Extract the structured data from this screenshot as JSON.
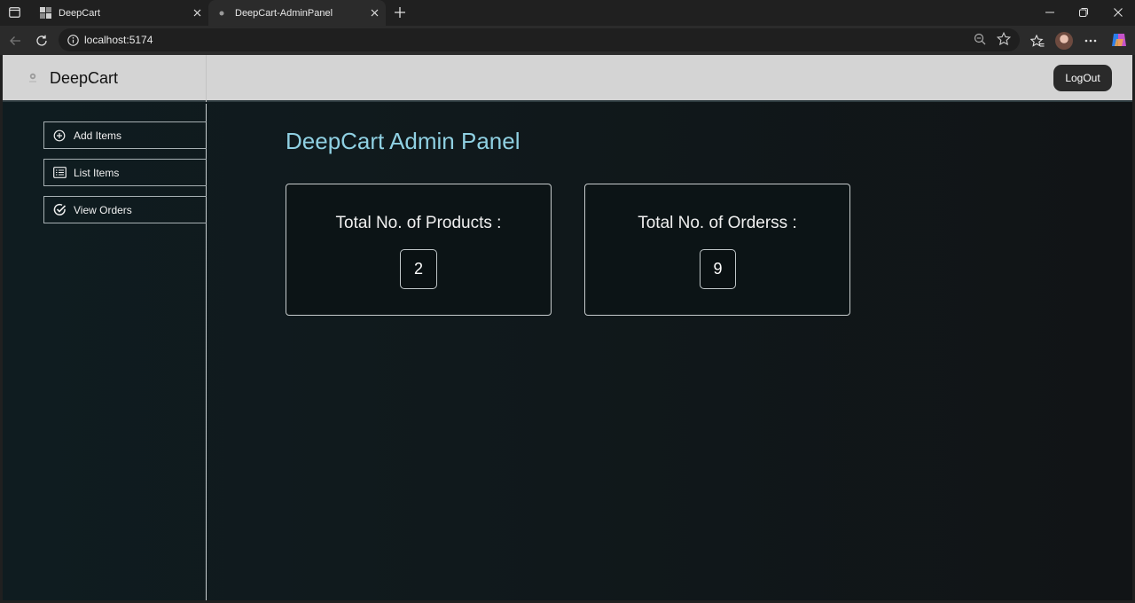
{
  "browser": {
    "tabs": [
      {
        "title": "DeepCart",
        "active": false
      },
      {
        "title": "DeepCart-AdminPanel",
        "active": true
      }
    ],
    "url": "localhost:5174"
  },
  "navbar": {
    "brand": "DeepCart",
    "logout_label": "LogOut"
  },
  "sidebar": {
    "items": [
      {
        "label": "Add Items",
        "icon": "add-circle-icon"
      },
      {
        "label": "List Items",
        "icon": "list-icon"
      },
      {
        "label": "View Orders",
        "icon": "check-circle-icon"
      }
    ]
  },
  "main": {
    "title": "DeepCart Admin Panel",
    "cards": [
      {
        "label": "Total No. of Products :",
        "value": "2"
      },
      {
        "label": "Total No. of Orderss :",
        "value": "9"
      }
    ]
  },
  "colors": {
    "title_accent": "#8fd0e2",
    "navbar_bg": "#d4d4d4",
    "page_bg": "#0f1c20",
    "logout_bg": "#2a2a2a"
  }
}
